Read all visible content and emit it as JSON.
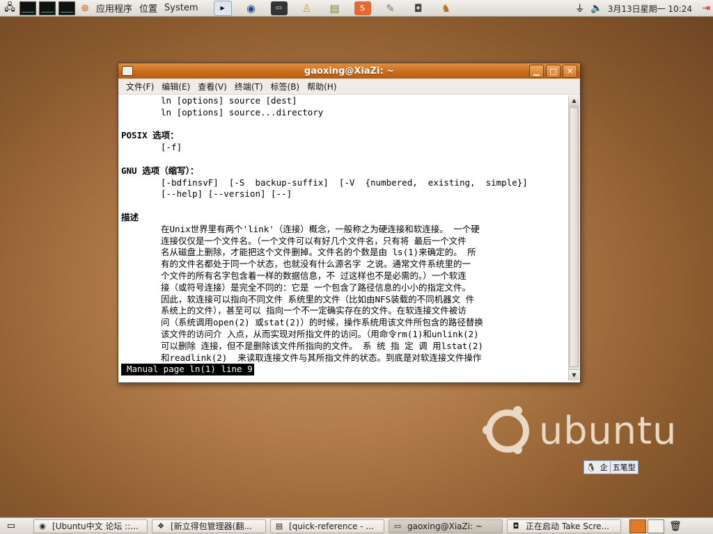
{
  "top_panel": {
    "menus": [
      "应用程序",
      "位置",
      "System"
    ],
    "clock": "3月13日星期一 10:24",
    "launchers": [
      "mplayer-icon",
      "globe-icon",
      "terminal-icon",
      "person-icon",
      "books-icon",
      "app-icon",
      "gimp-icon",
      "camera-icon",
      "rabbit-icon"
    ]
  },
  "window": {
    "title": "gaoxing@XiaZi: ~",
    "minimize": "▁",
    "maximize": "□",
    "close": "✕",
    "menus": [
      "文件(F)",
      "编辑(E)",
      "查看(V)",
      "终端(T)",
      "标签(B)",
      "帮助(H)"
    ]
  },
  "terminal": {
    "lines": [
      {
        "text": "ln [options] source [dest]",
        "indent": true,
        "bold": false
      },
      {
        "text": "ln [options] source...directory",
        "indent": true,
        "bold": false
      },
      {
        "text": "",
        "indent": false,
        "bold": false
      },
      {
        "text": "POSIX 选项：",
        "indent": false,
        "bold": true
      },
      {
        "text": "[-f]",
        "indent": true,
        "bold": false
      },
      {
        "text": "",
        "indent": false,
        "bold": false
      },
      {
        "text": "GNU 选项（缩写）：",
        "indent": false,
        "bold": true
      },
      {
        "text": "[-bdfinsvF]  [-S  backup-suffix]  [-V  {numbered,  existing,  simple}]",
        "indent": true,
        "bold": false
      },
      {
        "text": "[--help] [--version] [--]",
        "indent": true,
        "bold": false
      },
      {
        "text": "",
        "indent": false,
        "bold": false
      },
      {
        "text": "描述",
        "indent": false,
        "bold": true
      },
      {
        "text": "在Unix世界里有两个'link'（连接）概念，一般称之为硬连接和软连接。 一个硬",
        "indent": true,
        "bold": false
      },
      {
        "text": "连接仅仅是一个文件名。（一个文件可以有好几个文件名，只有将 最后一个文件",
        "indent": true,
        "bold": false
      },
      {
        "text": "名从磁盘上删除，才能把这个文件删掉。文件名的个数是由 ls(1)来确定的。 所",
        "indent": true,
        "bold": false
      },
      {
        "text": "有的文件名都处于同一个状态，也就没有什么源名字 之说。通常文件系统里的一",
        "indent": true,
        "bold": false
      },
      {
        "text": "个文件的所有名字包含着一样的数据信息，不 过这样也不是必需的。）一个软连",
        "indent": true,
        "bold": false
      },
      {
        "text": "接（或符号连接）是完全不同的：它是 一个包含了路径信息的小小的指定文件。",
        "indent": true,
        "bold": false
      },
      {
        "text": "因此，软连接可以指向不同文件 系统里的文件（比如由NFS装载的不同机器文 件",
        "indent": true,
        "bold": false
      },
      {
        "text": "系统上的文件），甚至可以 指向一个不一定确实存在的文件。在软连接文件被访",
        "indent": true,
        "bold": false
      },
      {
        "text": "问（系统调用open(2) 或stat(2)）的时候，操作系统用该文件所包含的路径替换",
        "indent": true,
        "bold": false
      },
      {
        "text": "该文件的访问介 入点，从而实现对所指文件的访问。（用命令rm(1)和unlink(2)",
        "indent": true,
        "bold": false
      },
      {
        "text": "可以删除 连接，但不是删除该文件所指向的文件。 系 统 指 定 调 用lstat(2)",
        "indent": true,
        "bold": false
      },
      {
        "text": "和readlink(2)  来读取连接文件与其所指文件的状态。到底是对软连接文件操作",
        "indent": true,
        "bold": false
      }
    ],
    "status": "Manual page ln(1) line 9"
  },
  "desktop": {
    "logo_text": "ubuntu",
    "ime": [
      "企",
      "五笔型"
    ]
  },
  "taskbar": {
    "tasks": [
      {
        "label": "[Ubuntu中文 论坛 ::...",
        "icon": "globe-icon",
        "active": false
      },
      {
        "label": "[新立得包管理器(翻...",
        "icon": "package-icon",
        "active": false
      },
      {
        "label": "[quick-reference - ...",
        "icon": "document-icon",
        "active": false
      },
      {
        "label": "gaoxing@XiaZi: ~",
        "icon": "terminal-icon",
        "active": true
      },
      {
        "label": "正在启动 Take Scre...",
        "icon": "camera-icon",
        "active": false
      }
    ]
  }
}
